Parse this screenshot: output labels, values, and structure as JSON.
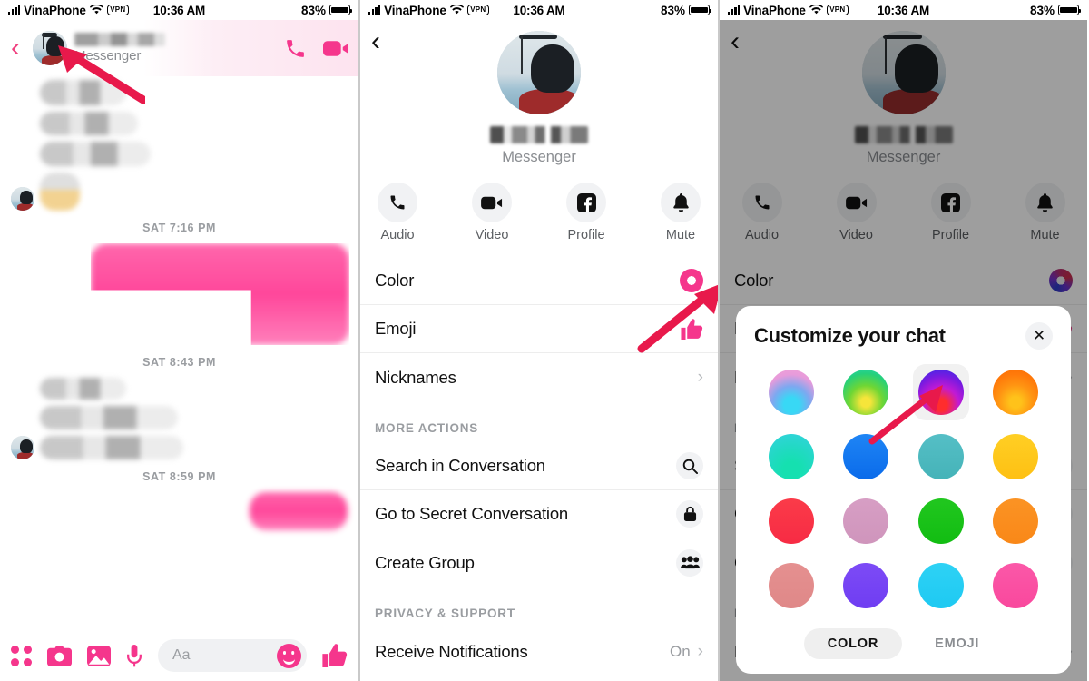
{
  "status_bar": {
    "carrier": "VinaPhone",
    "vpn": "VPN",
    "time": "10:36 AM",
    "battery_pct": "83%",
    "wifi_icon": "wifi-icon",
    "signal_icon": "signal-bars-icon",
    "battery_icon": "battery-icon"
  },
  "left_panel": {
    "back_icon": "chevron-left-icon",
    "contact_subtitle": "Messenger",
    "audio_call_icon": "phone-icon",
    "video_call_icon": "video-camera-icon",
    "timestamps": [
      "SAT 7:16 PM",
      "SAT 8:43 PM",
      "SAT 8:59 PM"
    ],
    "composer": {
      "apps_icon": "four-dots-icon",
      "camera_icon": "camera-icon",
      "gallery_icon": "photo-icon",
      "mic_icon": "microphone-icon",
      "input_placeholder": "Aa",
      "sticker_icon": "smiley-icon",
      "like_icon": "thumbs-up-icon"
    }
  },
  "detail_panel": {
    "back_icon": "chevron-left-icon",
    "subtitle": "Messenger",
    "actions": [
      {
        "label": "Audio",
        "icon": "phone-icon"
      },
      {
        "label": "Video",
        "icon": "video-camera-icon"
      },
      {
        "label": "Profile",
        "icon": "facebook-icon"
      },
      {
        "label": "Mute",
        "icon": "bell-icon"
      }
    ],
    "rows": [
      {
        "label": "Color",
        "icon": "color-donut-icon",
        "value": ""
      },
      {
        "label": "Emoji",
        "icon": "thumbs-up-icon",
        "value": ""
      },
      {
        "label": "Nicknames",
        "icon": "chevron-right-icon",
        "value": ""
      }
    ],
    "section_more_actions": "MORE ACTIONS",
    "more_actions": [
      {
        "label": "Search in Conversation",
        "icon": "search-icon"
      },
      {
        "label": "Go to Secret Conversation",
        "icon": "lock-icon"
      },
      {
        "label": "Create Group",
        "icon": "people-icon"
      }
    ],
    "section_privacy": "PRIVACY & SUPPORT",
    "privacy_rows": [
      {
        "label": "Receive Notifications",
        "value": "On",
        "icon": "chevron-right-icon"
      }
    ]
  },
  "modal": {
    "title": "Customize your chat",
    "close_icon": "close-icon",
    "selected_index": 2,
    "swatches": [
      {
        "name": "pink-cyan-gradient",
        "css": "radial-gradient(circle at 50% 78%, #38d8f5 0 18%, #7ea8f0 45%, #e79bdb 72%, #f3a3d4 100%)"
      },
      {
        "name": "green-yellow-gradient",
        "css": "radial-gradient(circle at 50% 72%, #f6e53a 0 12%, #6fd634 42%, #26d07a 72%, #27d5c0 100%)"
      },
      {
        "name": "blue-purple-red-gradient",
        "css": "radial-gradient(circle at 50% 78%, #ff2d2d 0 14%, #c21ad4 42%, #7a1ae0 68%, #2a2fe8 100%)"
      },
      {
        "name": "orange-gradient",
        "css": "radial-gradient(circle at 50% 72%, #ffc21a 0 14%, #ff9412 44%, #ff7a0a 70%, #fb6a00 100%)"
      },
      {
        "name": "teal-turquoise",
        "css": "radial-gradient(circle at 50% 80%, #15e0b0 0 20%, #22d9c4 55%, #35d2e0 100%)"
      },
      {
        "name": "blue",
        "css": "linear-gradient(180deg,#1f85f5 0%, #0a6bea 100%)"
      },
      {
        "name": "dark-teal",
        "css": "linear-gradient(180deg,#55bfc6 0%, #45b3b8 100%)"
      },
      {
        "name": "yellow",
        "css": "linear-gradient(180deg,#ffcf24 0%, #fec013 100%)"
      },
      {
        "name": "red",
        "css": "linear-gradient(180deg,#fb3b49 0%, #f72b44 100%)"
      },
      {
        "name": "dusty-pink",
        "css": "linear-gradient(180deg,#d79ec4 0%, #cf95bc 100%)"
      },
      {
        "name": "green",
        "css": "linear-gradient(180deg,#21c71f 0%, #12bd12 100%)"
      },
      {
        "name": "orange",
        "css": "linear-gradient(180deg,#fb9324 0%, #f98818 100%)"
      },
      {
        "name": "salmon",
        "css": "linear-gradient(180deg,#e59090 0%, #df8888 100%)"
      },
      {
        "name": "violet",
        "css": "linear-gradient(180deg,#7d4bf6 0%, #6f3df2 100%)"
      },
      {
        "name": "sky-blue",
        "css": "linear-gradient(180deg,#2ed2f5 0%, #1ec9f2 100%)"
      },
      {
        "name": "hot-pink",
        "css": "linear-gradient(180deg,#fb58a8 0%, #f9489d 100%)"
      }
    ],
    "tabs": [
      {
        "label": "COLOR",
        "active": true
      },
      {
        "label": "EMOJI",
        "active": false
      }
    ]
  },
  "colors": {
    "accent_pink": "#f5368c",
    "arrow_red": "#e8194b",
    "text_primary": "#111111",
    "text_muted": "#9a9da1"
  }
}
